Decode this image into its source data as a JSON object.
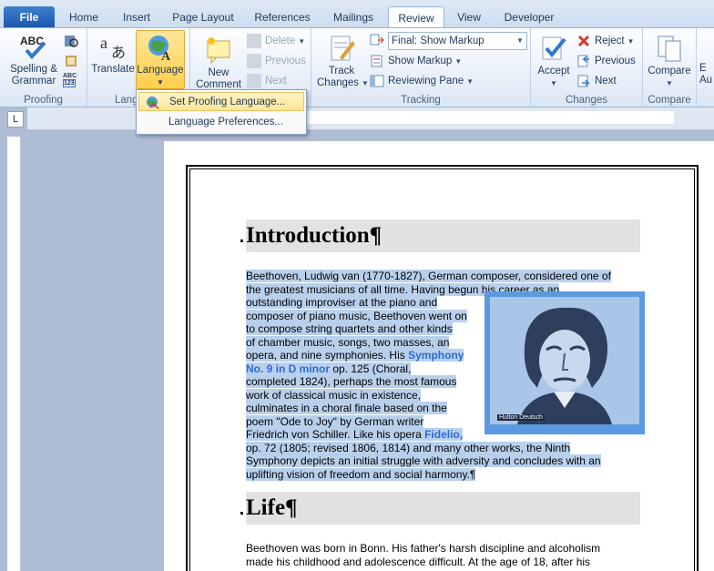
{
  "tabs": [
    "File",
    "Home",
    "Insert",
    "Page Layout",
    "References",
    "Mailings",
    "Review",
    "View",
    "Developer"
  ],
  "active_tab": "Review",
  "ribbon": {
    "proofing": {
      "label": "Proofing",
      "spelling": "Spelling &",
      "grammar": "Grammar",
      "abc": "ABC"
    },
    "language": {
      "label": "Lang",
      "translate": "Translate",
      "language": "Language"
    },
    "comments": {
      "new": "New",
      "comment": "Comment",
      "delete": "Delete",
      "previous": "Previous",
      "next": "Next"
    },
    "tracking": {
      "label": "Tracking",
      "track": "Track",
      "changes": "Changes",
      "display_value": "Final: Show Markup",
      "show_markup": "Show Markup",
      "reviewing_pane": "Reviewing Pane"
    },
    "changes": {
      "label": "Changes",
      "accept": "Accept",
      "reject": "Reject",
      "previous": "Previous",
      "next": "Next"
    },
    "compare": {
      "label": "Compare",
      "compare": "Compare",
      "partial": "E",
      "partial2": "Au"
    }
  },
  "menu": {
    "items": [
      "Set Proofing Language...",
      "Language Preferences..."
    ]
  },
  "document": {
    "heading1": "Introduction¶",
    "heading2": "Life¶",
    "p1_lines": [
      "Beethoven, Ludwig van (1770-1827), German composer, considered one of",
      "the greatest musicians of all time. Having begun his career as an",
      "outstanding improviser at the piano and",
      "composer of piano music, Beethoven went on",
      "to compose string quartets and other kinds",
      "of chamber music, songs, two masses, an",
      "opera, and nine symphonies. His ",
      "",
      "completed 1824), perhaps the most famous",
      "work of classical music in existence,",
      "culminates in a choral finale based on the",
      "poem \"Ode to Joy\" by German writer",
      "Friedrich von Schiller. Like his opera ",
      "op. 72 (1805; revised 1806, 1814) and many other works, the Ninth",
      "Symphony depicts an initial struggle with adversity and concludes with an",
      "uplifting vision of freedom and social harmony.¶"
    ],
    "symphony_a": "Symphony",
    "symphony_b": "No. 9 in D minor",
    "symphony_after": " op. 125 (Choral,",
    "fidelio": "Fidelio,",
    "image_credit": "Hulton Deutsch",
    "p2_lines": [
      "Beethoven was born in Bonn. His father's harsh discipline and alcoholism",
      "made his childhood and adolescence difficult. At the age of 18, after his"
    ]
  }
}
